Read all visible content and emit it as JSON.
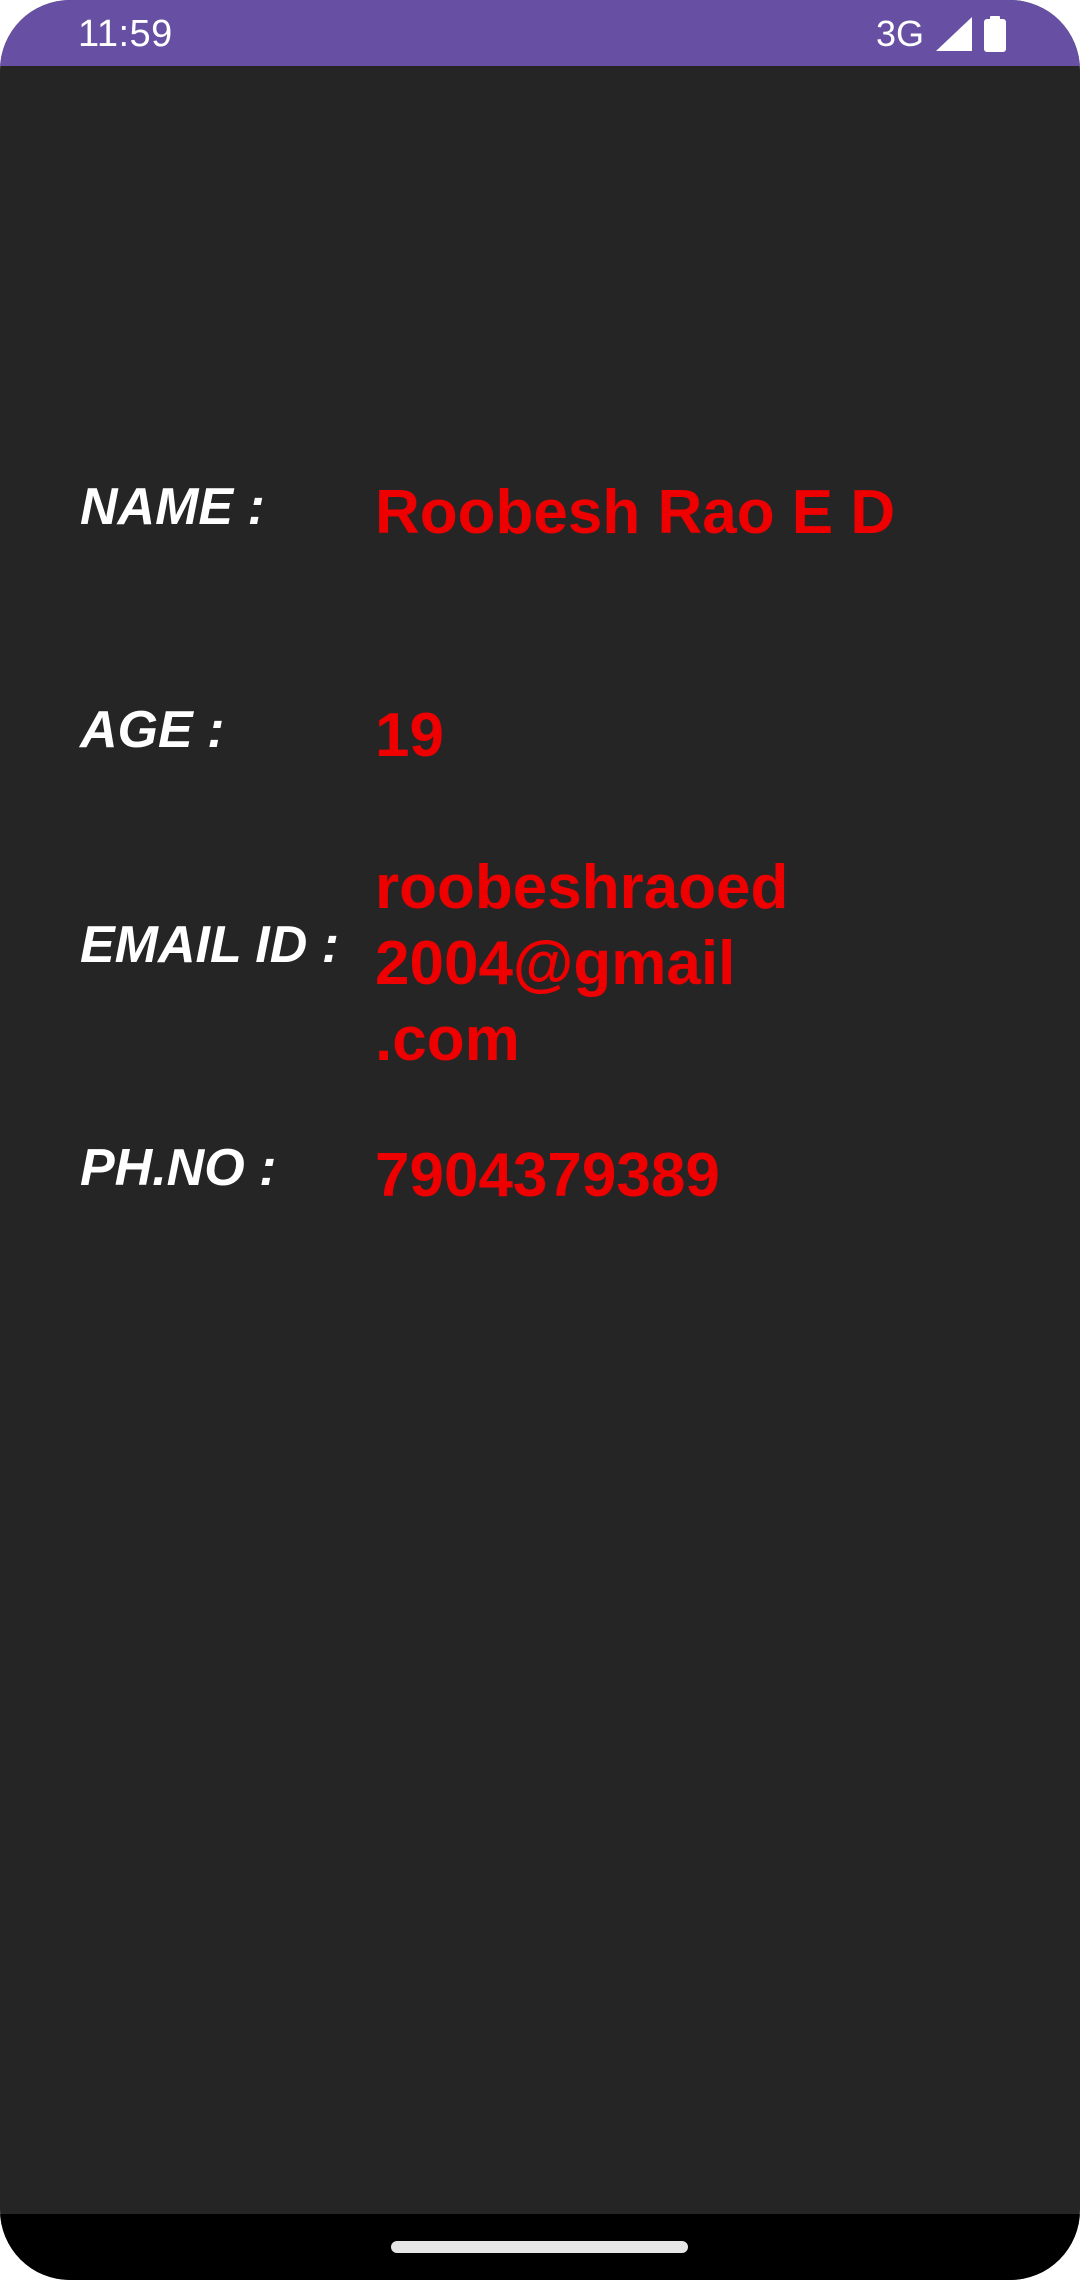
{
  "status_bar": {
    "time": "11:59",
    "network": "3G",
    "signal_icon": "cellular-signal-icon",
    "battery_icon": "battery-full-icon",
    "color": "#6750a4"
  },
  "profile": {
    "name_label": "NAME :",
    "name_value": "Roobesh Rao E D",
    "age_label": "AGE :",
    "age_value": "19",
    "email_label": "EMAIL ID :",
    "email_value_lines": [
      "roobeshraoed",
      "2004@gmail",
      ".com"
    ],
    "phone_label": "PH.NO :",
    "phone_value": "7904379389"
  },
  "colors": {
    "background": "#262526",
    "label_text": "#ffffff",
    "value_text": "#ee0000"
  }
}
